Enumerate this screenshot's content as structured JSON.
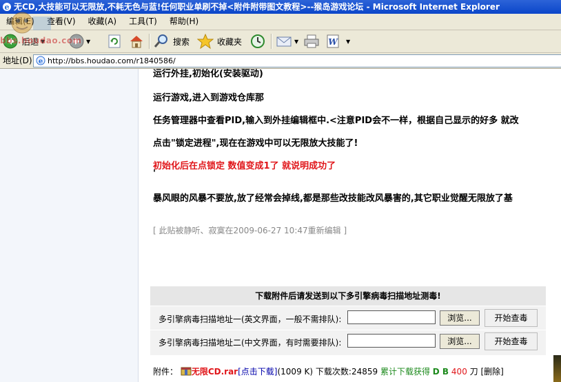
{
  "window": {
    "title": "无CD,大技能可以无限放,不耗无色与蓝!任何职业单刷不掉<附件附带图文教程>--猴岛游戏论坛 - Microsoft Internet Explorer"
  },
  "menubar": {
    "items": [
      "编辑(E)",
      "查看(V)",
      "收藏(A)",
      "工具(T)",
      "帮助(H)"
    ]
  },
  "toolbar": {
    "back_label": "后退",
    "search_label": "搜索",
    "favorites_label": "收藏夹"
  },
  "addressbar": {
    "label": "地址(D)",
    "url": "http://bbs.houdao.com/r1840586/"
  },
  "watermark": {
    "text": "bbs.houdao.com"
  },
  "post": {
    "line1": "运行外挂,初始化(安装驱动)",
    "line2": "运行游戏,进入到游戏仓库那",
    "line3": "任务管理器中查看PID,输入到外挂编辑框中.<注意PID会不一样，根据自己显示的好多  就改",
    "line4": "点击\"锁定进程\",现在在游戏中可以无限放大技能了!",
    "line5_red": "初始化后在点锁定  数值变成1了  就说明成功了",
    "line6": "'",
    "line7": "暴风眼的风暴不要放,放了经常会掉线,都是那些改技能改风暴害的,其它职业觉醒无限放了基",
    "edit_note": "[ 此贴被静听、寂寞在2009-06-27 10:47重新编辑  ]"
  },
  "scan": {
    "header": "下载附件后请发送到以下多引擎病毒扫描地址测毒!",
    "rows": [
      {
        "label": "多引擎病毒扫描地址一(英文界面，一般不需排队):",
        "browse": "浏览...",
        "start": "开始查毒"
      },
      {
        "label": "多引擎病毒扫描地址二(中文界面，有时需要排队):",
        "browse": "浏览...",
        "start": "开始查毒"
      }
    ]
  },
  "attachment": {
    "prefix": "附件：",
    "filename": "无限CD.rar",
    "click_download": "[点击下载]",
    "size": "(1009 K)",
    "downloads_label": "下载次数:24859",
    "earn_label": "累计下载获得",
    "db_label": "D B",
    "db_value": "400",
    "unit": "刀",
    "delete": "[删除]"
  },
  "colors": {
    "titlebar": "#0b46c9",
    "chrome": "#ece9d8",
    "red_text": "#e0161a",
    "green_text": "#1d8a1d",
    "link": "#0000aa"
  }
}
